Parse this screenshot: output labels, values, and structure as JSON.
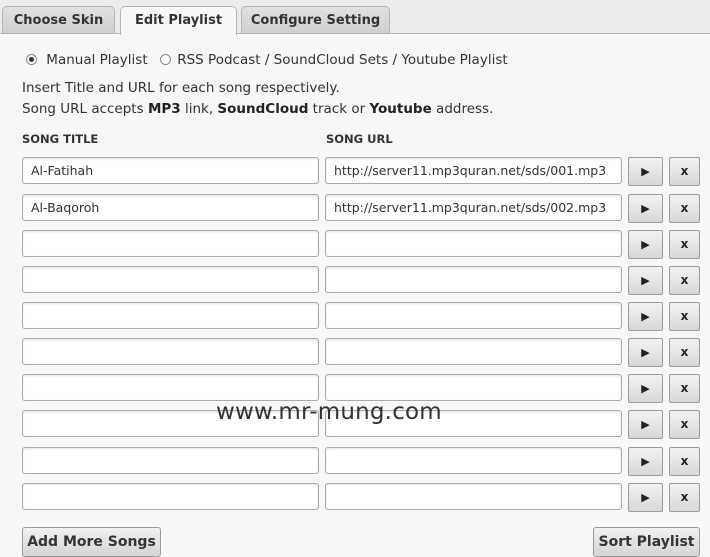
{
  "tabs": [
    {
      "label": "Choose Skin",
      "active": false
    },
    {
      "label": "Edit Playlist",
      "active": true
    },
    {
      "label": "Configure Setting",
      "active": false
    }
  ],
  "playlist_type": {
    "manual_label": "Manual Playlist",
    "rss_label": "RSS Podcast / SoundCloud Sets / Youtube Playlist",
    "selected": "manual"
  },
  "help": {
    "line1": "Insert Title and URL for each song respectively.",
    "line2_parts": [
      "Song URL accepts ",
      "MP3",
      " link, ",
      "SoundCloud",
      " track or ",
      "Youtube",
      " address."
    ]
  },
  "columns": {
    "title": "SONG TITLE",
    "url": "SONG URL"
  },
  "songs": [
    {
      "title": "Al-Fatihah",
      "url": "http://server11.mp3quran.net/sds/001.mp3"
    },
    {
      "title": "Al-Baqoroh",
      "url": "http://server11.mp3quran.net/sds/002.mp3"
    },
    {
      "title": "",
      "url": ""
    },
    {
      "title": "",
      "url": ""
    },
    {
      "title": "",
      "url": ""
    },
    {
      "title": "",
      "url": ""
    },
    {
      "title": "",
      "url": ""
    },
    {
      "title": "",
      "url": ""
    },
    {
      "title": "",
      "url": ""
    },
    {
      "title": "",
      "url": ""
    }
  ],
  "row_buttons": {
    "play": "▶",
    "delete": "x"
  },
  "watermark": "www.mr-mung.com",
  "footer": {
    "add_more": "Add More Songs",
    "sort": "Sort Playlist"
  }
}
